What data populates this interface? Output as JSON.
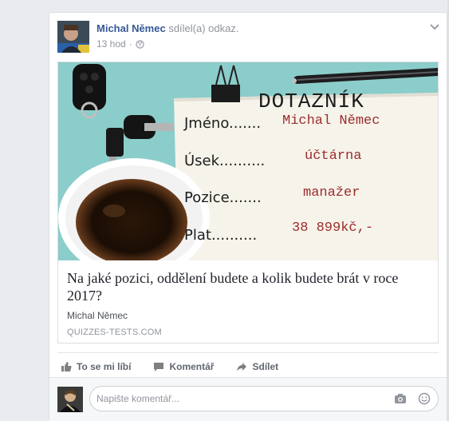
{
  "post": {
    "author_name": "Michal Němec",
    "action_text": "sdílel(a) odkaz.",
    "timestamp": "13 hod",
    "privacy_icon": "globe-icon",
    "menu_icon": "chevron-down-icon"
  },
  "link_preview": {
    "image": {
      "heading": "DOTAZNÍK",
      "rows": [
        {
          "label": "Jméno.......",
          "value": "Michal Němec"
        },
        {
          "label": "Úsek..........",
          "value": "účtárna"
        },
        {
          "label": "Pozice.......",
          "value": "manažer"
        },
        {
          "label": "Plat..........",
          "value": "38 899kč,-"
        }
      ]
    },
    "title": "Na jaké pozici, oddělení budete a kolik budete brát v roce 2017?",
    "author": "Michal Němec",
    "domain": "QUIZZES-TESTS.COM"
  },
  "actions": {
    "like": "To se mi líbí",
    "comment": "Komentář",
    "share": "Sdílet"
  },
  "comment_box": {
    "placeholder": "Napište komentář...",
    "camera_icon": "camera-icon",
    "emoji_icon": "emoji-icon"
  },
  "colors": {
    "author_link": "#365899",
    "muted_text": "#90949c",
    "action_text": "#616770",
    "page_bg": "#e9ebee",
    "questionnaire_value": "#9b2d2d",
    "image_bg": "#8fcfca"
  }
}
